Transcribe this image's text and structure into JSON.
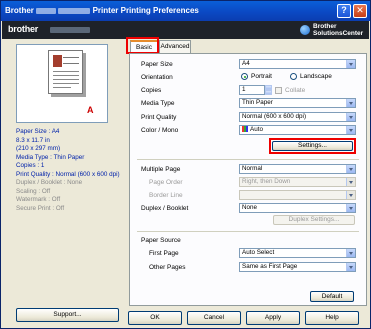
{
  "window": {
    "title": "Brother",
    "title_suffix": "Printer Printing Preferences",
    "help_glyph": "?",
    "close_glyph": "✕"
  },
  "banner": {
    "brand": "brother",
    "solutions_line1": "Brother",
    "solutions_line2": "SolutionsCenter"
  },
  "summary": {
    "paper_size": "Paper Size : A4",
    "dims1": "8.3 x 11.7 in",
    "dims2": "(210 x 297 mm)",
    "media_type": "Media Type : Thin Paper",
    "copies": "Copies : 1",
    "print_quality": "Print Quality : Normal (600 x 600 dpi)",
    "duplex": "Duplex / Booklet : None",
    "scaling": "Scaling : Off",
    "watermark": "Watermark : Off",
    "secure_print": "Secure Print : Off"
  },
  "left": {
    "support_label": "Support..."
  },
  "tabs": {
    "basic": "Basic",
    "advanced": "Advanced"
  },
  "basic": {
    "paper_size": {
      "label": "Paper Size",
      "value": "A4"
    },
    "orientation": {
      "label": "Orientation",
      "portrait": "Portrait",
      "landscape": "Landscape",
      "selected": "portrait"
    },
    "copies": {
      "label": "Copies",
      "value": "1",
      "collate": "Collate"
    },
    "media_type": {
      "label": "Media Type",
      "value": "Thin Paper"
    },
    "print_quality": {
      "label": "Print Quality",
      "value": "Normal (600 x 600 dpi)"
    },
    "color_mono": {
      "label": "Color / Mono",
      "value": "Auto"
    },
    "settings_button": "Settings...",
    "multiple_page": {
      "label": "Multiple Page",
      "value": "Normal"
    },
    "page_order": {
      "label": "Page Order",
      "value": "Right, then Down"
    },
    "border_line": {
      "label": "Border Line",
      "value": ""
    },
    "duplex_booklet": {
      "label": "Duplex / Booklet",
      "value": "None"
    },
    "duplex_settings_button": "Duplex Settings...",
    "paper_source": {
      "label": "Paper Source"
    },
    "first_page": {
      "label": "First Page",
      "value": "Auto Select"
    },
    "other_pages": {
      "label": "Other Pages",
      "value": "Same as First Page"
    },
    "default_button": "Default"
  },
  "footer": {
    "ok": "OK",
    "cancel": "Cancel",
    "apply": "Apply",
    "help": "Help"
  },
  "colors": {
    "title_bar": "#0b4ac6",
    "highlight": "#ee0000",
    "link_text": "#0022aa"
  }
}
